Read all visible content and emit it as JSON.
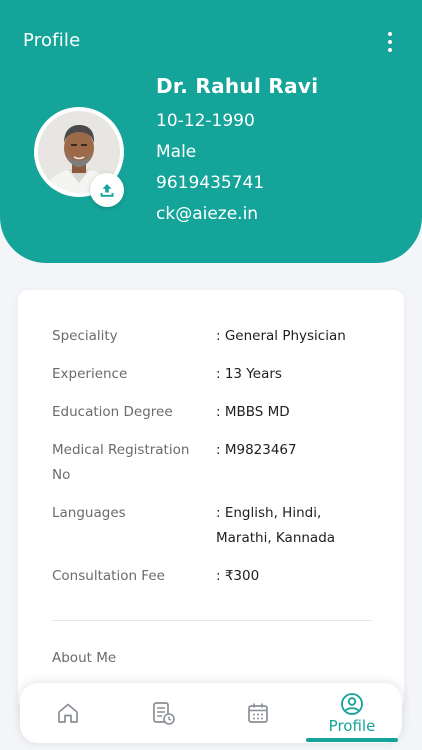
{
  "header": {
    "title": "Profile",
    "menu_icon": "more-vertical-icon"
  },
  "profile": {
    "name": "Dr. Rahul Ravi",
    "dob": "10-12-1990",
    "gender": "Male",
    "phone": "9619435741",
    "email": "ck@aieze.in",
    "upload_icon": "upload-icon"
  },
  "details": [
    {
      "label": "Speciality",
      "value": ": General Physician"
    },
    {
      "label": "Experience",
      "value": ": 13 Years"
    },
    {
      "label": "Education Degree",
      "value": ": MBBS MD"
    },
    {
      "label": "Medical Registration No",
      "value": ": M9823467"
    },
    {
      "label": "Languages",
      "value": ": English, Hindi, Marathi, Kannada"
    },
    {
      "label": "Consultation Fee",
      "value": ": ₹300"
    }
  ],
  "about": {
    "label": "About Me"
  },
  "nav": {
    "items": [
      {
        "icon": "home-icon"
      },
      {
        "icon": "records-clock-icon"
      },
      {
        "icon": "calendar-icon"
      },
      {
        "icon": "user-circle-icon",
        "label": "Profile",
        "active": true
      }
    ]
  },
  "colors": {
    "accent": "#15a49a",
    "background": "#f3f5f8",
    "card": "#ffffff"
  }
}
